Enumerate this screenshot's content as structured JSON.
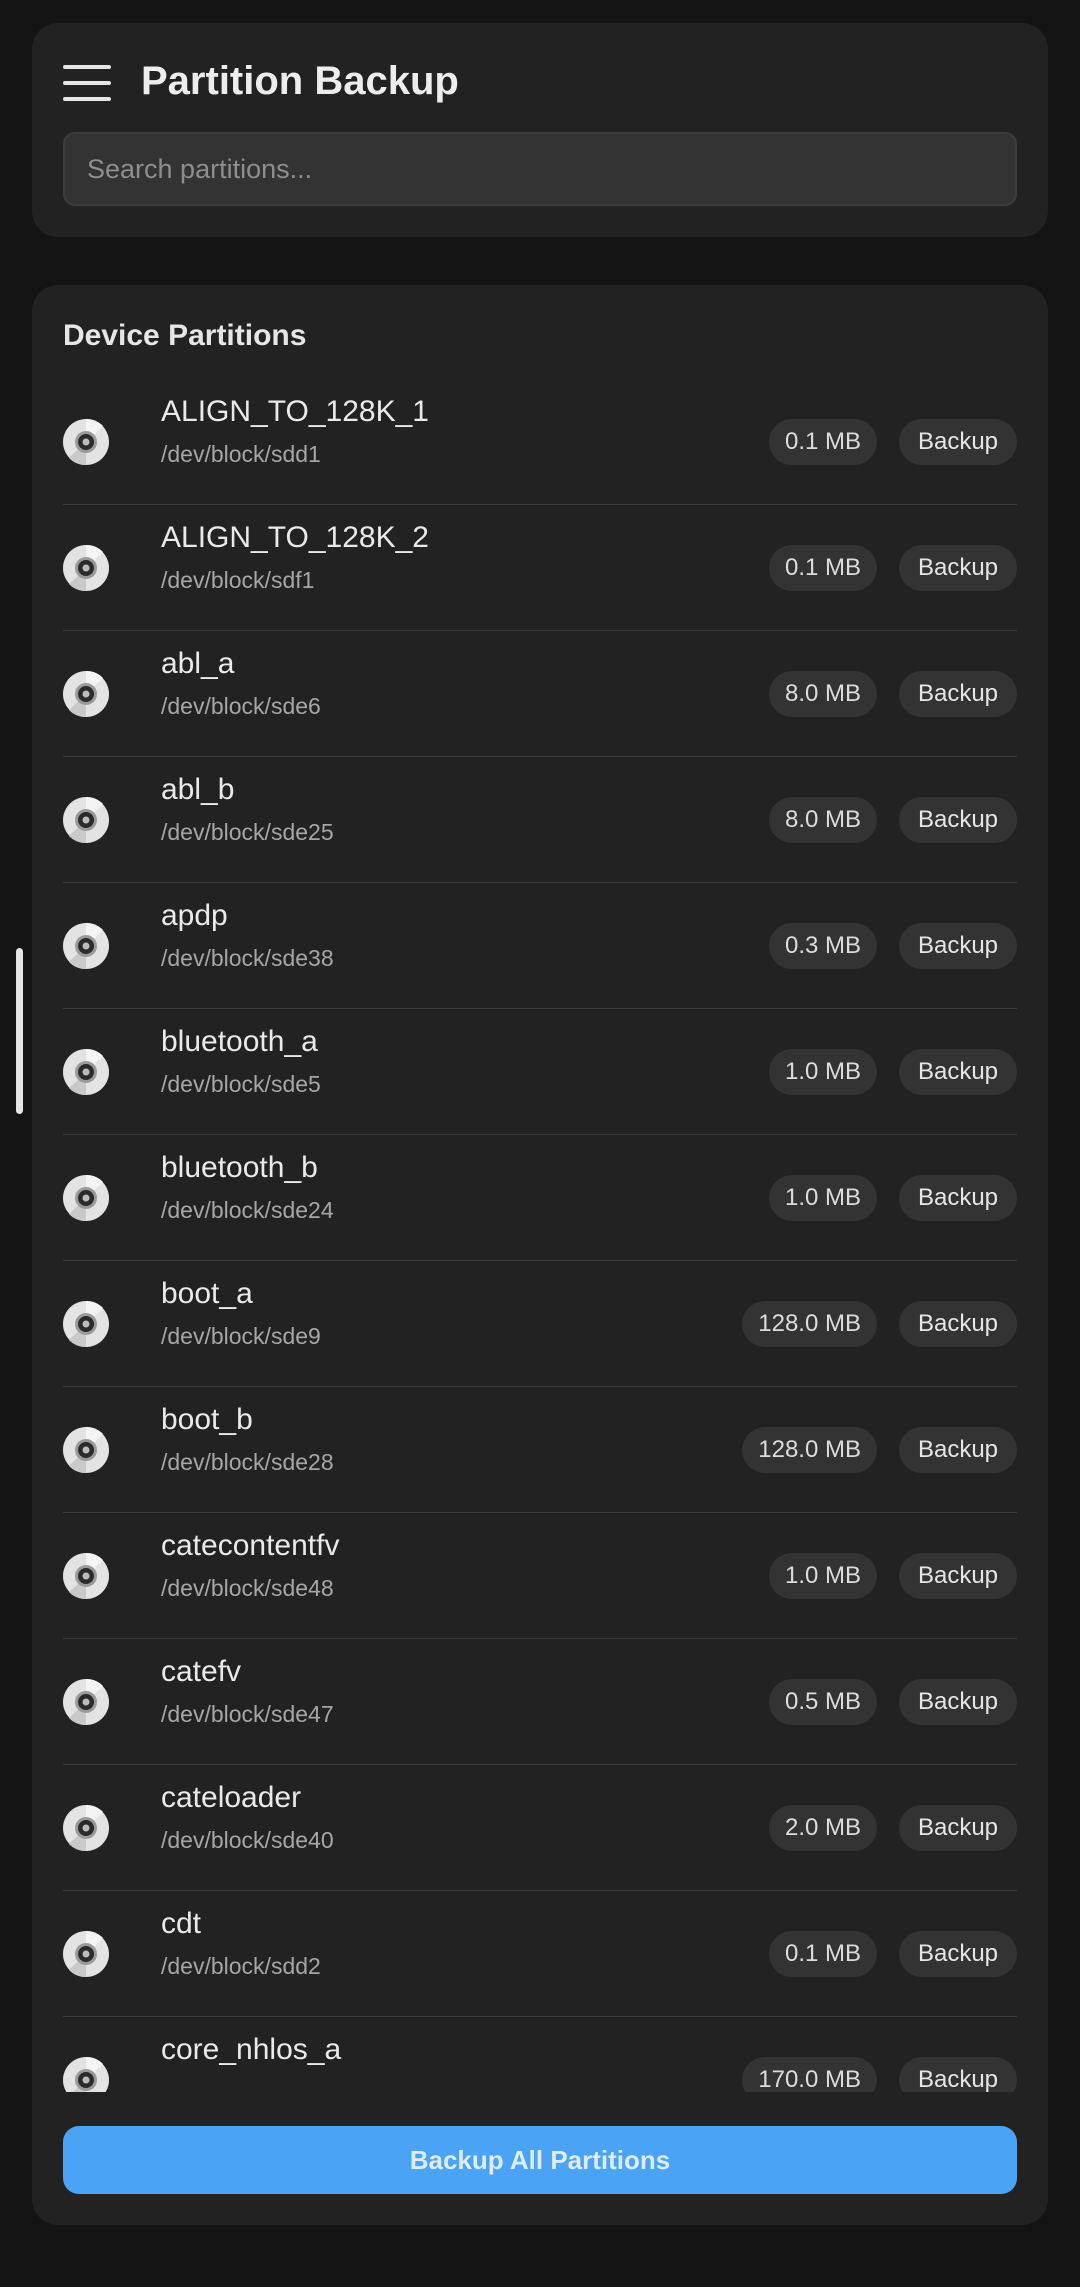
{
  "header": {
    "title": "Partition Backup",
    "search_placeholder": "Search partitions..."
  },
  "section": {
    "title": "Device Partitions"
  },
  "icons": {
    "menu": "hamburger-menu-icon",
    "partition": "disk-icon"
  },
  "partitions": [
    {
      "name": "ALIGN_TO_128K_1",
      "path": "/dev/block/sdd1",
      "size": "0.1 MB",
      "action": "Backup"
    },
    {
      "name": "ALIGN_TO_128K_2",
      "path": "/dev/block/sdf1",
      "size": "0.1 MB",
      "action": "Backup"
    },
    {
      "name": "abl_a",
      "path": "/dev/block/sde6",
      "size": "8.0 MB",
      "action": "Backup"
    },
    {
      "name": "abl_b",
      "path": "/dev/block/sde25",
      "size": "8.0 MB",
      "action": "Backup"
    },
    {
      "name": "apdp",
      "path": "/dev/block/sde38",
      "size": "0.3 MB",
      "action": "Backup"
    },
    {
      "name": "bluetooth_a",
      "path": "/dev/block/sde5",
      "size": "1.0 MB",
      "action": "Backup"
    },
    {
      "name": "bluetooth_b",
      "path": "/dev/block/sde24",
      "size": "1.0 MB",
      "action": "Backup"
    },
    {
      "name": "boot_a",
      "path": "/dev/block/sde9",
      "size": "128.0 MB",
      "action": "Backup"
    },
    {
      "name": "boot_b",
      "path": "/dev/block/sde28",
      "size": "128.0 MB",
      "action": "Backup"
    },
    {
      "name": "catecontentfv",
      "path": "/dev/block/sde48",
      "size": "1.0 MB",
      "action": "Backup"
    },
    {
      "name": "catefv",
      "path": "/dev/block/sde47",
      "size": "0.5 MB",
      "action": "Backup"
    },
    {
      "name": "cateloader",
      "path": "/dev/block/sde40",
      "size": "2.0 MB",
      "action": "Backup"
    },
    {
      "name": "cdt",
      "path": "/dev/block/sdd2",
      "size": "0.1 MB",
      "action": "Backup"
    },
    {
      "name": "core_nhlos_a",
      "path": "",
      "size": "170.0 MB",
      "action": "Backup"
    }
  ],
  "footer": {
    "backup_all_label": "Backup All Partitions"
  },
  "colors": {
    "background": "#141414",
    "card": "#222222",
    "accent": "#4aa3f5"
  }
}
